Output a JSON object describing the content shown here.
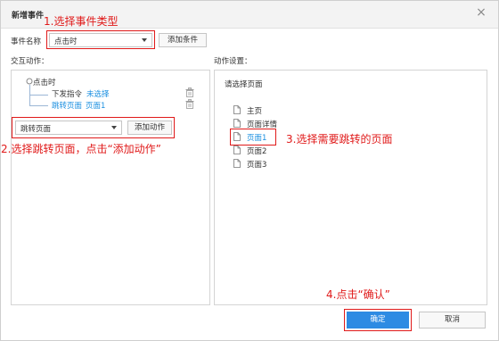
{
  "dialog": {
    "title": "新增事件",
    "close_icon": "×"
  },
  "event_name": {
    "label": "事件名称",
    "value": "点击时",
    "add_condition_label": "添加条件"
  },
  "interaction": {
    "label": "交互动作：",
    "root": "点击时",
    "actions": [
      {
        "name": "下发指令",
        "detail": "未选择"
      },
      {
        "name": "跳转页面",
        "detail": "页面1"
      }
    ],
    "action_select_value": "跳转页面",
    "add_action_label": "添加动作"
  },
  "action_settings": {
    "label": "动作设置：",
    "select_page_label": "请选择页面",
    "pages": [
      "主页",
      "页面详情",
      "页面1",
      "页面2",
      "页面3"
    ],
    "selected_page": "页面1"
  },
  "footer": {
    "ok_label": "确定",
    "cancel_label": "取消"
  },
  "annotations": {
    "step1": "1.选择事件类型",
    "step2": "2.选择跳转页面，点击“添加动作”",
    "step3": "3.选择需要跳转的页面",
    "step4": "4.点击“确认”"
  },
  "colors": {
    "accent": "#2d8be3",
    "link": "#1a8fe0",
    "annotation": "#e01a1a"
  }
}
